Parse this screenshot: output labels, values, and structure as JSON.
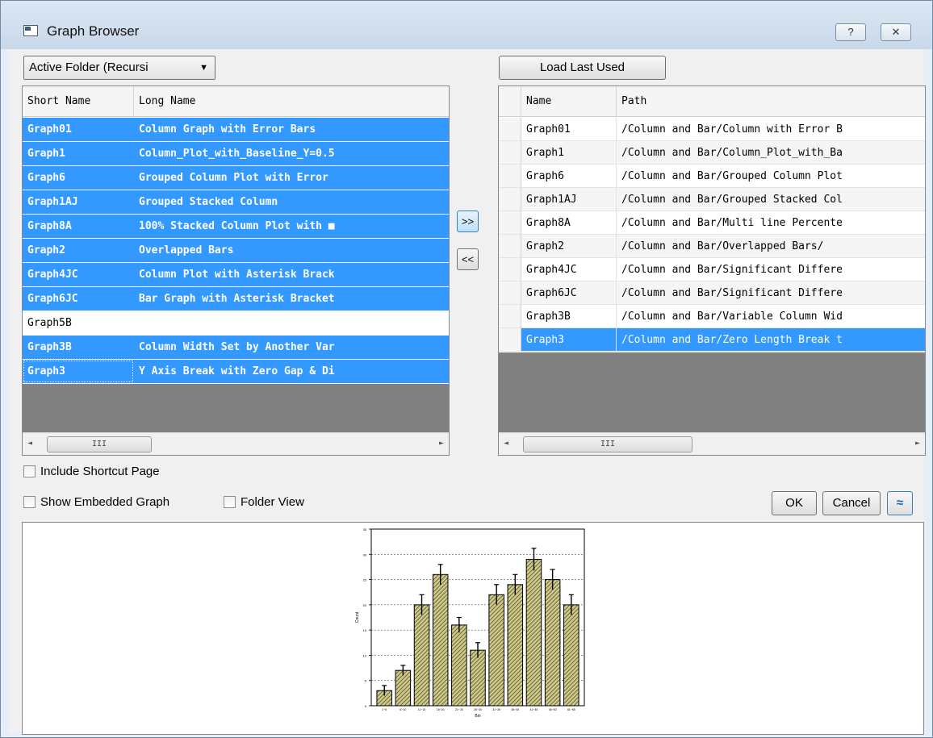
{
  "window": {
    "title": "Graph Browser",
    "help_label": "?",
    "close_label": "✕"
  },
  "folder_dropdown": {
    "value": "Active Folder (Recursi"
  },
  "load_button": {
    "label": "Load Last Used"
  },
  "left_table": {
    "headers": [
      "Short Name",
      "Long Name"
    ],
    "rows": [
      {
        "short": "Graph01",
        "long": "Column Graph with Error Bars",
        "selected": true
      },
      {
        "short": "Graph1",
        "long": "Column_Plot_with_Baseline_Y=0.5",
        "selected": true
      },
      {
        "short": "Graph6",
        "long": "Grouped Column Plot with Error",
        "selected": true
      },
      {
        "short": "Graph1AJ",
        "long": "Grouped Stacked Column",
        "selected": true
      },
      {
        "short": "Graph8A",
        "long": "100% Stacked Column Plot with ■",
        "selected": true
      },
      {
        "short": "Graph2",
        "long": "Overlapped Bars",
        "selected": true
      },
      {
        "short": "Graph4JC",
        "long": "Column Plot with Asterisk Brack",
        "selected": true
      },
      {
        "short": "Graph6JC",
        "long": "Bar Graph with Asterisk Bracket",
        "selected": true
      },
      {
        "short": "Graph5B",
        "long": "",
        "selected": false
      },
      {
        "short": "Graph3B",
        "long": "Column Width Set by Another Var",
        "selected": true
      },
      {
        "short": "Graph3",
        "long": "Y Axis Break with Zero Gap & Di",
        "selected": true
      }
    ]
  },
  "right_table": {
    "headers": [
      "Name",
      "Path"
    ],
    "rows": [
      {
        "name": "Graph01",
        "path": "/Column and Bar/Column with Error B",
        "selected": false
      },
      {
        "name": "Graph1",
        "path": "/Column and Bar/Column_Plot_with_Ba",
        "selected": false
      },
      {
        "name": "Graph6",
        "path": "/Column and Bar/Grouped Column Plot",
        "selected": false
      },
      {
        "name": "Graph1AJ",
        "path": "/Column and Bar/Grouped Stacked Col",
        "selected": false
      },
      {
        "name": "Graph8A",
        "path": "/Column and Bar/Multi line Percente",
        "selected": false
      },
      {
        "name": "Graph2",
        "path": "/Column and Bar/Overlapped Bars/",
        "selected": false
      },
      {
        "name": "Graph4JC",
        "path": "/Column and Bar/Significant Differe",
        "selected": false
      },
      {
        "name": "Graph6JC",
        "path": "/Column and Bar/Significant Differe",
        "selected": false
      },
      {
        "name": "Graph3B",
        "path": "/Column and Bar/Variable Column Wid",
        "selected": false
      },
      {
        "name": "Graph3",
        "path": "/Column and Bar/Zero Length Break t",
        "selected": true
      }
    ]
  },
  "transfer": {
    "add_label": ">>",
    "remove_label": "<<"
  },
  "scroll_thumb_label": "III",
  "options": {
    "include_shortcut": "Include Shortcut Page",
    "show_embedded": "Show Embedded Graph",
    "folder_view": "Folder View"
  },
  "actions": {
    "ok": "OK",
    "cancel": "Cancel",
    "expand": "≈"
  },
  "chart_data": {
    "type": "bar",
    "xlabel": "Bin",
    "ylabel": "Count",
    "categories": [
      "1~5",
      "6~10",
      "11~15",
      "16~20",
      "21~25",
      "26~30",
      "31~35",
      "36~40",
      "41~45",
      "46~50",
      "51~55",
      "56~60"
    ],
    "values": [
      3,
      7,
      20,
      26,
      16,
      11,
      22,
      24,
      29,
      25,
      20
    ],
    "errors": [
      1,
      1,
      2,
      2,
      1.5,
      1.5,
      2,
      2,
      2.2,
      2,
      2
    ],
    "ylim": [
      0,
      35
    ],
    "grid": true,
    "bar_color": "#b5b070"
  }
}
